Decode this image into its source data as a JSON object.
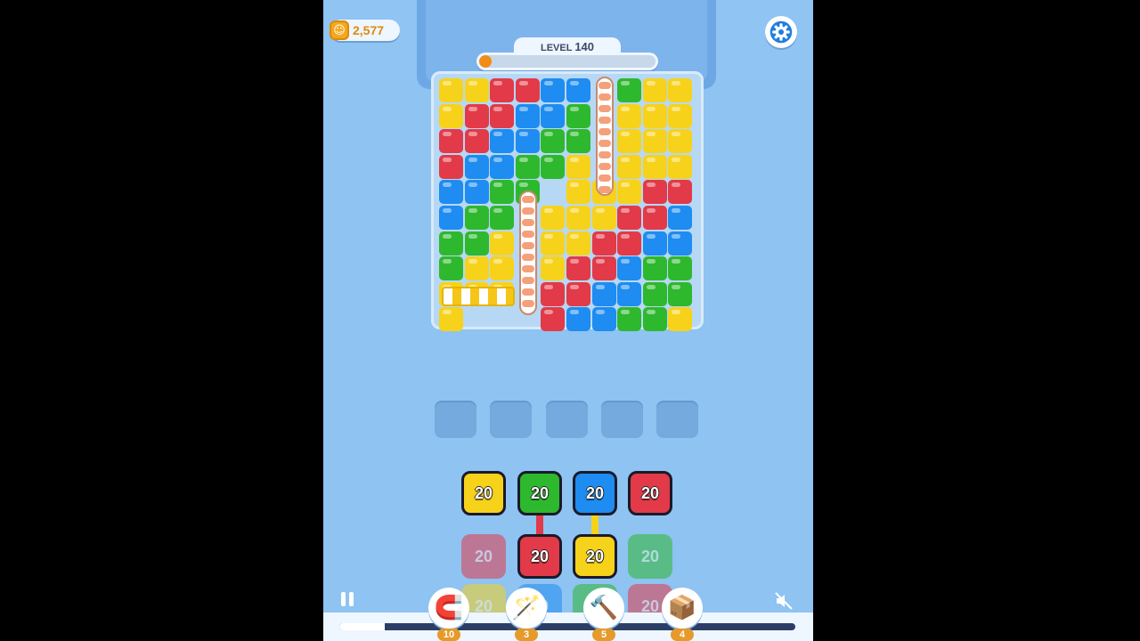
{
  "hud": {
    "coins": "2,577",
    "level_prefix": "LEVEL",
    "level_number": "140",
    "level_progress": 0.04,
    "icons": {
      "coin": "coin-icon",
      "settings": "gear-icon",
      "pause": "pause-icon",
      "mute": "muted-speaker-icon"
    }
  },
  "colors": {
    "Y": "#f7d21a",
    "R": "#e23a48",
    "B": "#1e8cf0",
    "G": "#2eb82e",
    "accent": "#f08c18"
  },
  "board": {
    "rows": [
      "YYRRBB.GYY",
      "YRRBBG.YYY",
      "RRBBGG.YYY",
      "RBBGGY.YYY",
      "BBGG.YYYRR",
      "BGG.YYYRRB",
      "GGY.YYRRBB",
      "GYY.YRRBGG",
      "YYY.RRBBGG",
      "Y...RBBGGY"
    ]
  },
  "buffer_slots": 5,
  "holders": [
    {
      "label": "20",
      "color": "Y",
      "active": true
    },
    {
      "label": "20",
      "color": "G",
      "active": true
    },
    {
      "label": "20",
      "color": "B",
      "active": true
    },
    {
      "label": "20",
      "color": "R",
      "active": true
    },
    {
      "label": "20",
      "color": "R",
      "active": false
    },
    {
      "label": "20",
      "color": "R",
      "active": true
    },
    {
      "label": "20",
      "color": "Y",
      "active": true
    },
    {
      "label": "20",
      "color": "G",
      "active": false
    },
    {
      "label": "20",
      "color": "Y",
      "active": false
    },
    {
      "label": "20",
      "color": "B",
      "active": false
    },
    {
      "label": "20",
      "color": "G",
      "active": false
    },
    {
      "label": "20",
      "color": "R",
      "active": false
    }
  ],
  "boosters": [
    {
      "name": "magnet-icon",
      "glyph": "🧲",
      "count": "10"
    },
    {
      "name": "magic-wand-icon",
      "glyph": "🪄",
      "count": "3"
    },
    {
      "name": "hammer-icon",
      "glyph": "🔨",
      "count": "5"
    },
    {
      "name": "shuffle-box-icon",
      "glyph": "📦",
      "count": "4"
    }
  ],
  "bottom_progress": 0.1
}
